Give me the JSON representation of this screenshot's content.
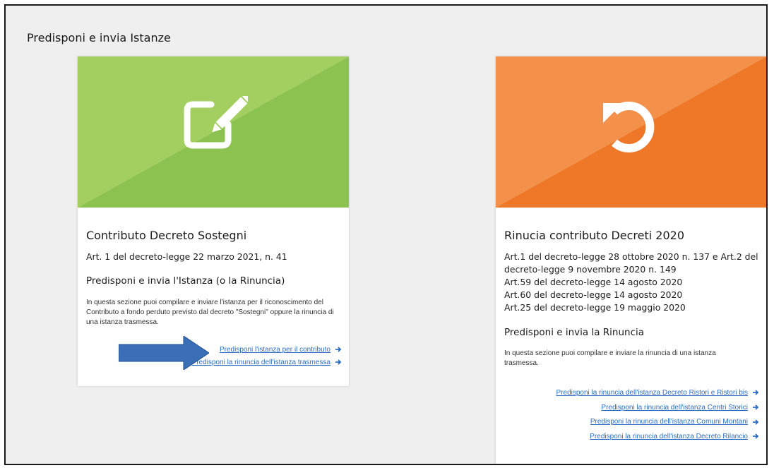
{
  "page": {
    "title": "Predisponi e invia Istanze"
  },
  "colors": {
    "green_light": "#a3cf60",
    "green_dark": "#8cc24f",
    "orange_light": "#f3914a",
    "orange_dark": "#ee7827",
    "link": "#2a6cc4",
    "annotation_arrow": "#3a6fb8"
  },
  "cards": [
    {
      "icon": "edit-icon",
      "title": "Contributo Decreto Sostegni",
      "refs": [
        "Art. 1 del decreto-legge 22 marzo 2021, n. 41"
      ],
      "subtitle": "Predisponi e invia l'Istanza (o la Rinuncia)",
      "description": "In questa sezione puoi compilare e inviare l'istanza per il riconoscimento del Contributo a fondo perduto previsto dal decreto \"Sostegni\" oppure la rinuncia di una istanza trasmessa.",
      "links": [
        "Predisponi l'istanza per il contributo",
        "Predisponi la rinuncia dell'istanza trasmessa"
      ]
    },
    {
      "icon": "undo-icon",
      "title": "Rinucia contributo Decreti 2020",
      "refs": [
        "Art.1 del decreto-legge 28 ottobre 2020 n. 137 e Art.2 del",
        "decreto-legge 9 novembre 2020 n. 149",
        "Art.59 del decreto-legge 14 agosto 2020",
        "Art.60 del decreto-legge 14 agosto 2020",
        "Art.25 del decreto-legge 19 maggio 2020"
      ],
      "subtitle": "Predisponi e invia la Rinuncia",
      "description": "In questa sezione puoi compilare e inviare la rinuncia di una istanza trasmessa.",
      "links": [
        "Predisponi la rinuncia dell'istanza Decreto Ristori e Ristori bis",
        "Predisponi la rinuncia dell'istanza Centri Storici",
        "Predisponi la rinuncia dell'istanza Comuni Montani",
        "Predisponi la rinuncia dell'istanza Decreto Rilancio"
      ]
    }
  ]
}
